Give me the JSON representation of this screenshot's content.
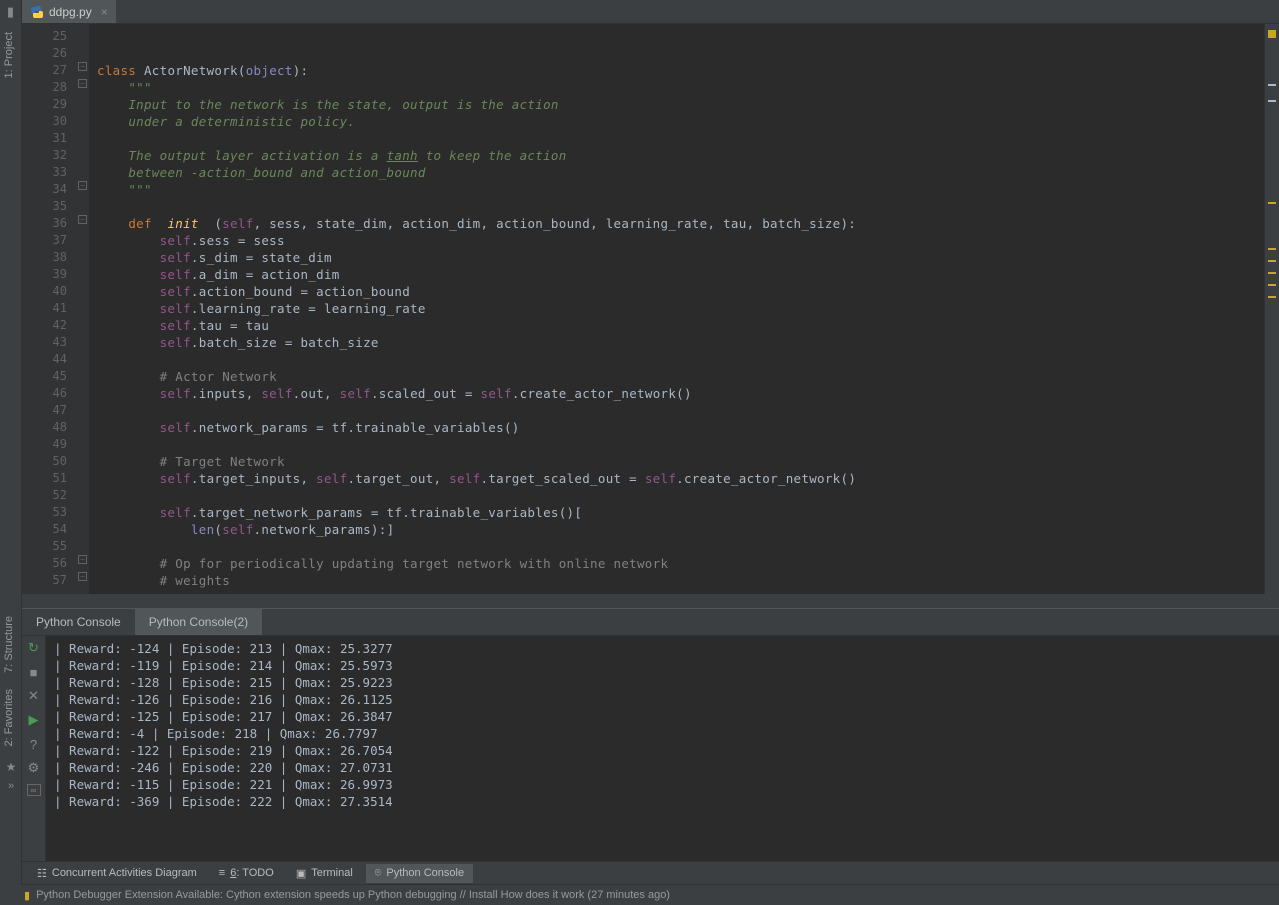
{
  "tab": {
    "filename": "ddpg.py"
  },
  "left_rail": {
    "items": [
      "1: Project",
      "7: Structure",
      "2: Favorites"
    ]
  },
  "gutter": {
    "start": 25,
    "end": 57
  },
  "code_lines": [
    "",
    "",
    "<span class='kw'>class </span><span class='cls'>ActorNetwork</span>(<span class='bi'>object</span>):",
    "    <span class='str'>\"\"\"</span>",
    "    <span class='str'>Input to the network is the state, output is the action</span>",
    "    <span class='str'>under a deterministic policy.</span>",
    "",
    "    <span class='str'>The output layer activation is a <span class='underline'>tanh</span> to keep the action</span>",
    "    <span class='str'>between -action_bound and action_bound</span>",
    "    <span class='str'>\"\"\"</span>",
    "",
    "    <span class='kw'>def </span> <span class='fn'>init</span>  (<span class='self'>self</span>, sess, state_dim, action_dim, action_bound, learning_rate, tau, batch_size):",
    "        <span class='self'>self</span>.sess = sess",
    "        <span class='self'>self</span>.s_dim = state_dim",
    "        <span class='self'>self</span>.a_dim = action_dim",
    "        <span class='self'>self</span>.action_bound = action_bound",
    "        <span class='self'>self</span>.learning_rate = learning_rate",
    "        <span class='self'>self</span>.tau = tau",
    "        <span class='self'>self</span>.batch_size = batch_size",
    "",
    "        <span class='comment'># Actor Network</span>",
    "        <span class='self'>self</span>.inputs, <span class='self'>self</span>.out, <span class='self'>self</span>.scaled_out = <span class='self'>self</span>.create_actor_network()",
    "",
    "        <span class='self'>self</span>.network_params = tf.trainable_variables()",
    "",
    "        <span class='comment'># Target Network</span>",
    "        <span class='self'>self</span>.target_inputs, <span class='self'>self</span>.target_out, <span class='self'>self</span>.target_scaled_out = <span class='self'>self</span>.create_actor_network()",
    "",
    "        <span class='self'>self</span>.target_network_params = tf.trainable_variables()[",
    "            <span class='bi'>len</span>(<span class='self'>self</span>.network_params):]",
    "",
    "        <span class='comment'># Op for periodically updating target network with online network</span>",
    "        <span class='comment'># weights</span>"
  ],
  "console": {
    "tabs": [
      "Python Console",
      "Python Console(2)"
    ],
    "lines": [
      "| Reward: -124 | Episode: 213 | Qmax: 25.3277",
      "| Reward: -119 | Episode: 214 | Qmax: 25.5973",
      "| Reward: -128 | Episode: 215 | Qmax: 25.9223",
      "| Reward: -126 | Episode: 216 | Qmax: 26.1125",
      "| Reward: -125 | Episode: 217 | Qmax: 26.3847",
      "| Reward: -4 | Episode: 218 | Qmax: 26.7797",
      "| Reward: -122 | Episode: 219 | Qmax: 26.7054",
      "| Reward: -246 | Episode: 220 | Qmax: 27.0731",
      "| Reward: -115 | Episode: 221 | Qmax: 26.9973",
      "| Reward: -369 | Episode: 222 | Qmax: 27.3514"
    ]
  },
  "bottom_toolbar": {
    "items": [
      {
        "icon": "☷",
        "label": "Concurrent Activities Diagram"
      },
      {
        "icon": "≡",
        "label": "6: TODO",
        "underline": "6"
      },
      {
        "icon": "▣",
        "label": "Terminal"
      },
      {
        "icon": "⌾",
        "label": "Python Console",
        "active": true
      }
    ]
  },
  "status": {
    "text": "Python Debugger Extension Available: Cython extension speeds up Python debugging // Install How does it work (27 minutes ago)"
  }
}
